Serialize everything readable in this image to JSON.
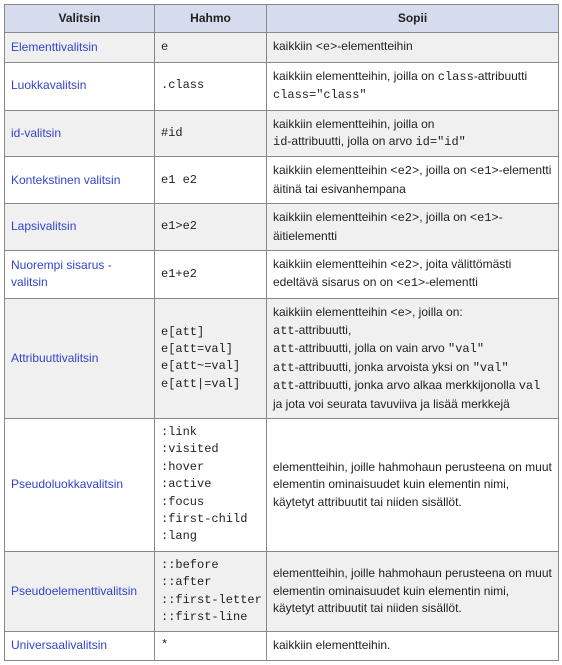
{
  "headers": {
    "c0": "Valitsin",
    "c1": "Hahmo",
    "c2": "Sopii"
  },
  "rows": [
    {
      "name": "Elementtivalitsin",
      "patterns": [
        "e"
      ],
      "desc": [
        {
          "t": "kaikkiin "
        },
        {
          "t": "<e>",
          "code": true
        },
        {
          "t": "-elementteihin"
        }
      ]
    },
    {
      "name": "Luokkavalitsin",
      "patterns": [
        ".class"
      ],
      "desc": [
        {
          "t": "kaikkiin elementteihin, joilla on "
        },
        {
          "t": "class",
          "code": true
        },
        {
          "t": "-attribuutti "
        },
        {
          "t": "class=\"class\"",
          "code": true
        }
      ]
    },
    {
      "name": "id-valitsin",
      "patterns": [
        "#id"
      ],
      "desc": [
        {
          "t": "kaikkiin elementteihin, joilla on "
        },
        {
          "br": true
        },
        {
          "t": "id",
          "code": true
        },
        {
          "t": "-attribuutti, jolla on arvo "
        },
        {
          "t": "id=\"id\"",
          "code": true
        }
      ]
    },
    {
      "name": "Kontekstinen valitsin",
      "patterns": [
        "e1 e2"
      ],
      "desc": [
        {
          "t": "kaikkiin elementteihin "
        },
        {
          "t": "<e2>",
          "code": true
        },
        {
          "t": ", joilla on "
        },
        {
          "t": "<e1>",
          "code": true
        },
        {
          "t": "-elementti äitinä tai esivanhempana"
        }
      ]
    },
    {
      "name": "Lapsivalitsin",
      "patterns": [
        "e1>e2"
      ],
      "desc": [
        {
          "t": "kaikkiin elementteihin "
        },
        {
          "t": "<e2>",
          "code": true
        },
        {
          "t": ", joilla on "
        },
        {
          "t": "<e1>",
          "code": true
        },
        {
          "t": "-äitielementti"
        }
      ]
    },
    {
      "name": "Nuorempi sisarus -valitsin",
      "patterns": [
        "e1+e2"
      ],
      "desc": [
        {
          "t": "kaikkiin elementteihin "
        },
        {
          "t": "<e2>",
          "code": true
        },
        {
          "t": ", joita välittömästi edeltävä sisarus on on "
        },
        {
          "t": "<e1>",
          "code": true
        },
        {
          "t": "-elementti"
        }
      ]
    },
    {
      "name": "Attribuuttivalitsin",
      "patterns": [
        "e[att]",
        "e[att=val]",
        "e[att~=val]",
        "e[att|=val]"
      ],
      "desc": [
        {
          "t": "kaikkiin elementteihin "
        },
        {
          "t": "<e>",
          "code": true
        },
        {
          "t": ", joilla on: "
        },
        {
          "br": true
        },
        {
          "t": "att",
          "code": true
        },
        {
          "t": "-attribuutti,"
        },
        {
          "br": true
        },
        {
          "t": "att",
          "code": true
        },
        {
          "t": "-attribuutti, jolla on vain arvo "
        },
        {
          "t": "\"val\"",
          "code": true
        },
        {
          "br": true
        },
        {
          "t": "att",
          "code": true
        },
        {
          "t": "-attribuutti, jonka arvoista yksi on "
        },
        {
          "t": "\"val\"",
          "code": true
        },
        {
          "br": true
        },
        {
          "t": "att",
          "code": true
        },
        {
          "t": "-attribuutti, jonka arvo alkaa merkkijonolla "
        },
        {
          "t": "val",
          "code": true
        },
        {
          "t": " ja jota voi seurata tavuviiva ja lisää merkkejä"
        }
      ]
    },
    {
      "name": "Pseudoluokkavalitsin",
      "patterns": [
        ":link",
        ":visited",
        ":hover",
        ":active",
        ":focus",
        ":first-child",
        ":lang"
      ],
      "desc": [
        {
          "t": "elementteihin, joille hahmohaun perusteena on muut elementin ominaisuudet kuin elementin nimi, käytetyt attribuutit tai niiden sisällöt."
        }
      ]
    },
    {
      "name": "Pseudoelementtivalitsin",
      "patterns": [
        "::before",
        "::after",
        "::first-letter",
        "::first-line"
      ],
      "desc": [
        {
          "t": "elementteihin, joille hahmohaun perusteena on muut elementin ominaisuudet kuin elementin nimi, käytetyt attribuutit tai niiden sisällöt."
        }
      ]
    },
    {
      "name": "Universaalivalitsin",
      "patterns": [
        "*"
      ],
      "desc": [
        {
          "t": "kaikkiin elementteihin."
        }
      ]
    }
  ]
}
